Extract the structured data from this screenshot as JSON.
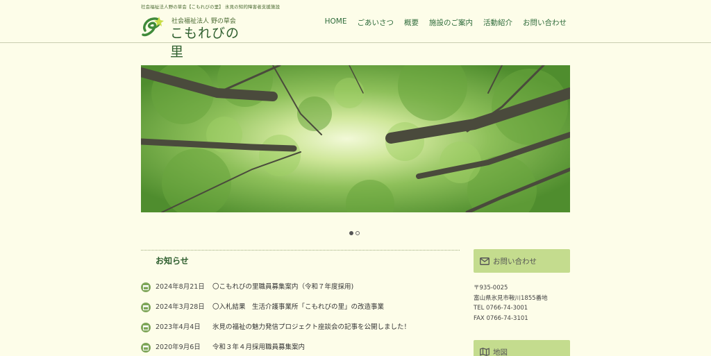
{
  "header": {
    "tagline": "社会福祉法人野の草会【こもれびの里】 氷見の知的障害者支援施設",
    "org_name": "社会福祉法人 野の草会",
    "site_name": "こもれびの里"
  },
  "nav": {
    "items": [
      "HOME",
      "ごあいさつ",
      "概要",
      "施設のご案内",
      "活動紹介",
      "お問い合わせ"
    ]
  },
  "news": {
    "title": "お知らせ",
    "items": [
      {
        "date": "2024年8月21日",
        "text": "〇こもれびの里職員募集案内（令和７年度採用)"
      },
      {
        "date": "2024年3月28日",
        "text": "〇入札結果　生活介護事業所「こもれびの里」の改造事業"
      },
      {
        "date": "2023年4月4日",
        "text": "氷見の福祉の魅力発信プロジェクト座談会の記事を公開しました！"
      },
      {
        "date": "2020年9月6日",
        "text": "令和３年４月採用職員募集案内"
      }
    ]
  },
  "sidebar": {
    "contact_label": "お問い合わせ",
    "address": {
      "postal": "〒935-0025",
      "street": "富山県氷見市鞍川1855番地",
      "tel": "TEL 0766-74-3001",
      "fax": "FAX 0766-74-3101"
    },
    "map_label": "地図"
  },
  "slider": {
    "slide_count": 2,
    "active_index": 0
  },
  "colors": {
    "accent": "#2e6b3a",
    "sidebar_box": "#c4dc8e",
    "background": "#fdfde9",
    "calendar_icon": "#7fa659"
  },
  "icons": [
    "logo-mark-icon",
    "calendar-icon",
    "envelope-icon",
    "map-icon"
  ]
}
